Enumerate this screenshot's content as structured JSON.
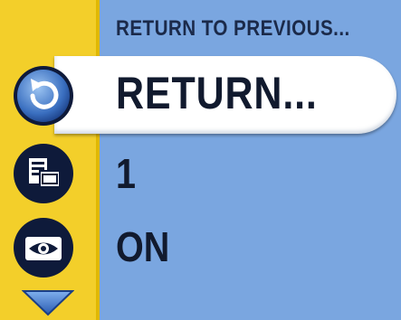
{
  "menu": {
    "header": "RETURN TO PREVIOUS...",
    "items": [
      {
        "label": "RETURN...",
        "icon": "return-arrow-icon",
        "selected": true
      },
      {
        "label": "1",
        "icon": "multi-picture-icon",
        "selected": false
      },
      {
        "label": "ON",
        "icon": "eye-review-icon",
        "selected": false
      }
    ],
    "scroll_indicator": "chevron-down-icon"
  },
  "colors": {
    "panel_blue": "#7aa6e0",
    "sidebar_yellow": "#f3cf2a",
    "icon_dark": "#0e1a3a",
    "highlight_white": "#ffffff"
  }
}
